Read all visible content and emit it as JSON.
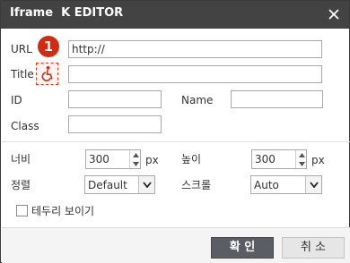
{
  "dialog": {
    "title": "Iframe  K EDITOR",
    "close_icon": "close-icon"
  },
  "fields": {
    "url_label": "URL",
    "url_value": "http://",
    "title_label": "Title",
    "id_label": "ID",
    "id_value": "",
    "name_label": "Name",
    "name_value": "",
    "class_label": "Class",
    "class_value": "",
    "title_value": ""
  },
  "annotation": {
    "badge_number": "1",
    "marker_icon": "wheelchair-icon",
    "marker_color": "#d32b12"
  },
  "size": {
    "width_label": "너비",
    "width_value": "300",
    "width_unit": "px",
    "height_label": "높이",
    "height_value": "300",
    "height_unit": "px"
  },
  "options": {
    "align_label": "정렬",
    "align_value": "Default",
    "scroll_label": "스크롤",
    "scroll_value": "Auto",
    "border_label": "테두리 보이기",
    "border_checked": false
  },
  "buttons": {
    "ok_label": "확 인",
    "cancel_label": "취 소"
  },
  "colors": {
    "titlebar": "#434343",
    "ok_button": "#5a5d63",
    "cancel_button": "#e6e6e6",
    "footer": "#f4f4f4"
  }
}
